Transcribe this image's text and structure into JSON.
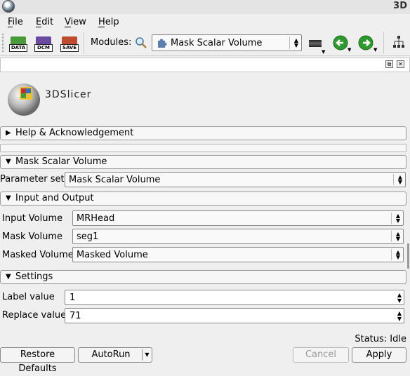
{
  "window": {
    "title": "3D"
  },
  "menu": {
    "file": "File",
    "edit": "Edit",
    "view": "View",
    "help": "Help"
  },
  "toolbar": {
    "data_label": "DATA",
    "dcm_label": "DCM",
    "save_label": "SAVE",
    "modules_label": "Modules:",
    "module_selected": "Mask Scalar Volume"
  },
  "logo": {
    "text": "3DSlicer"
  },
  "sections": {
    "help": "Help & Acknowledgement",
    "module": "Mask Scalar Volume",
    "io": "Input and Output",
    "settings": "Settings"
  },
  "parameter_set": {
    "label": "Parameter set:",
    "value": "Mask Scalar Volume"
  },
  "io": {
    "input_label": "Input Volume",
    "input_value": "MRHead",
    "mask_label": "Mask Volume",
    "mask_value": "seg1",
    "masked_label": "Masked Volume",
    "masked_value": "Masked Volume"
  },
  "settings": {
    "label_value_label": "Label value",
    "label_value": "1",
    "replace_value_label": "Replace value",
    "replace_value": "71"
  },
  "status": "Status: Idle",
  "buttons": {
    "restore_defaults": "Restore Defaults",
    "autorun": "AutoRun",
    "cancel": "Cancel",
    "apply": "Apply"
  },
  "colors": {
    "nav_green": "#2e9a2e",
    "data_icon": "#4a9a3a",
    "dcm_icon": "#6a4aa0",
    "save_icon": "#c04a30"
  }
}
